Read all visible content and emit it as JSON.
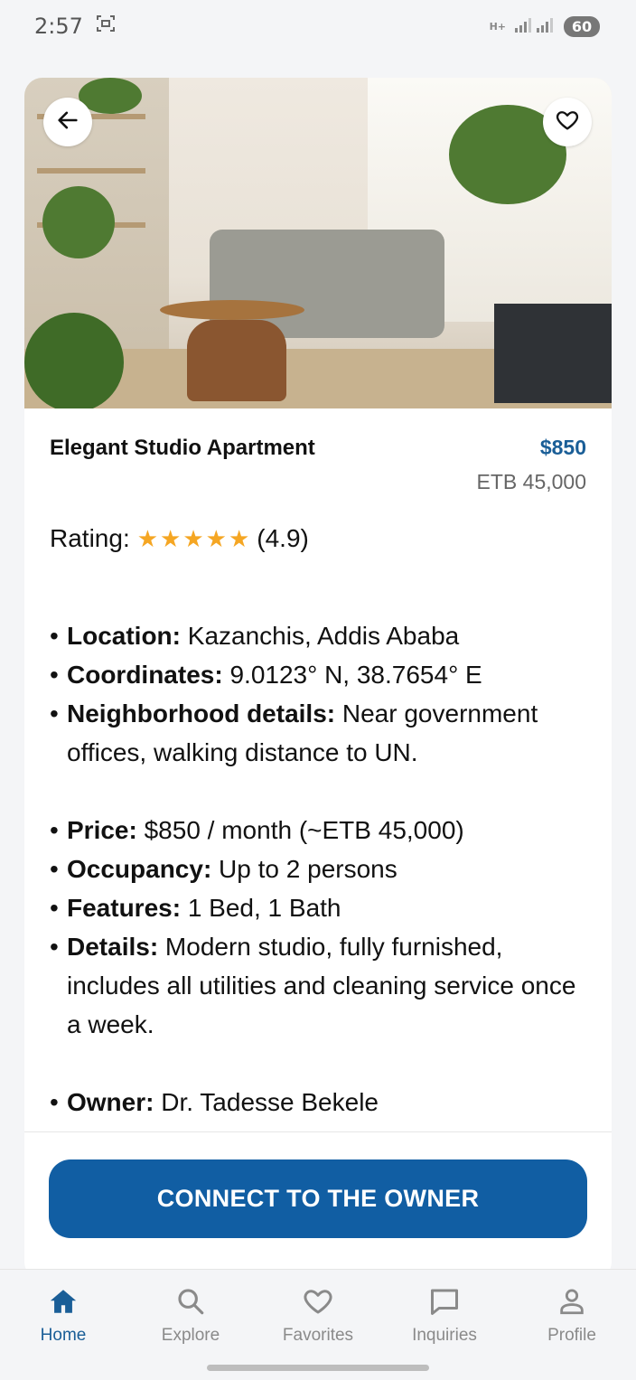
{
  "status_bar": {
    "time": "2:57",
    "network": "H+",
    "battery": "60"
  },
  "listing": {
    "title": "Elegant Studio Apartment",
    "price_usd": "$850",
    "price_etb": "ETB 45,000",
    "rating_label": "Rating:",
    "rating_value": "(4.9)",
    "stars": 5,
    "details": {
      "location_key": "Location:",
      "location_val": " Kazanchis, Addis Ababa",
      "coordinates_key": "Coordinates:",
      "coordinates_val": " 9.0123° N, 38.7654° E",
      "neighborhood_key": "Neighborhood details:",
      "neighborhood_val": " Near government offices, walking distance to UN.",
      "price_key": "Price:",
      "price_val": " $850 / month (~ETB 45,000)",
      "occupancy_key": "Occupancy:",
      "occupancy_val": " Up to 2 persons",
      "features_key": "Features:",
      "features_val": " 1 Bed, 1 Bath",
      "details_key": "Details:",
      "details_val": " Modern studio, fully furnished, includes all utilities and cleaning service once a week.",
      "owner_key": "Owner:",
      "owner_val": " Dr. Tadesse Bekele"
    },
    "cta_label": "CONNECT TO THE OWNER"
  },
  "nav": {
    "home": "Home",
    "explore": "Explore",
    "favorites": "Favorites",
    "inquiries": "Inquiries",
    "profile": "Profile"
  },
  "colors": {
    "accent": "#1a5e97",
    "cta": "#115ea3",
    "star": "#f5a623"
  },
  "icons": {
    "back": "arrow-left-icon",
    "favorite": "heart-outline-icon",
    "home": "home-icon",
    "explore": "search-icon",
    "favorites": "heart-icon",
    "inquiries": "chat-bubble-icon",
    "profile": "person-icon"
  }
}
